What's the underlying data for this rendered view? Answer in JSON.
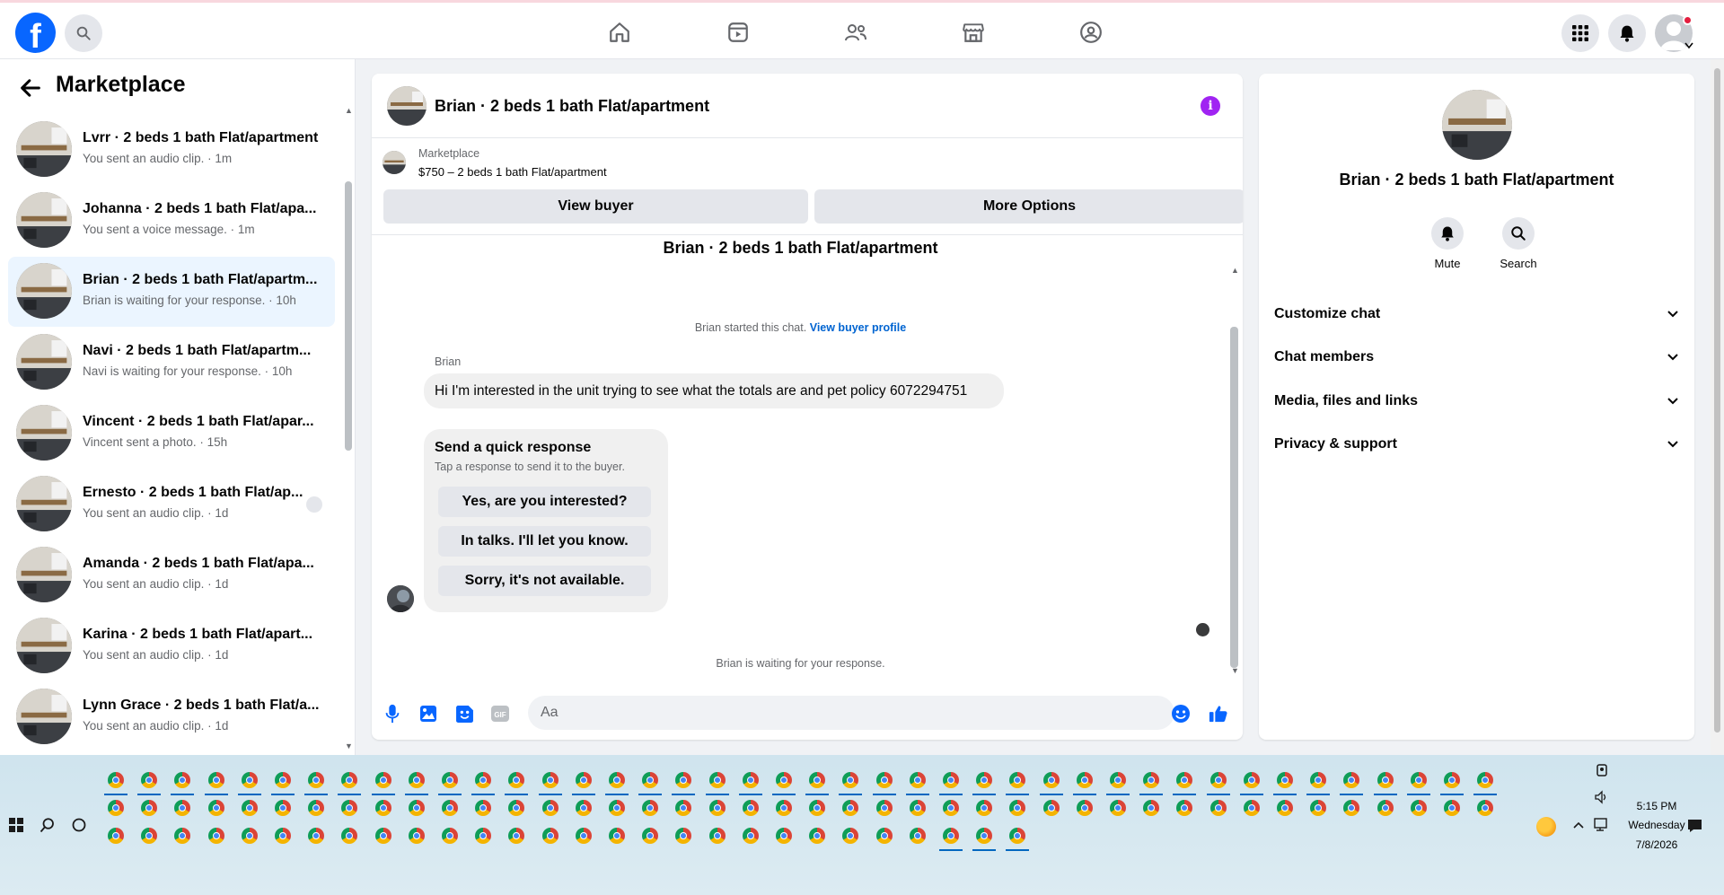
{
  "topbar": {
    "logo": "f",
    "nav_icons": [
      "home-icon",
      "video-icon",
      "friends-icon",
      "marketplace-icon",
      "groups-icon"
    ],
    "right_icons": [
      "menu-grid-icon",
      "bell-icon",
      "account-avatar"
    ]
  },
  "sidebar": {
    "title": "Marketplace",
    "conversations": [
      {
        "name": "Lvrr · 2 beds 1 bath Flat/apartment",
        "sub": "You sent an audio clip. · 1m"
      },
      {
        "name": "Johanna · 2 beds 1 bath Flat/apa...",
        "sub": "You sent a voice message. · 1m"
      },
      {
        "name": "Brian · 2 beds 1 bath Flat/apartm...",
        "sub": "Brian is waiting for your response. · 10h"
      },
      {
        "name": "Navi · 2 beds 1 bath Flat/apartm...",
        "sub": "Navi is waiting for your response. · 10h"
      },
      {
        "name": "Vincent · 2 beds 1 bath Flat/apar...",
        "sub": "Vincent sent a photo. · 15h"
      },
      {
        "name": "Ernesto · 2 beds 1 bath Flat/ap...",
        "sub": "You sent an audio clip. · 1d"
      },
      {
        "name": "Amanda · 2 beds 1 bath Flat/apa...",
        "sub": "You sent an audio clip. · 1d"
      },
      {
        "name": "Karina · 2 beds 1 bath Flat/apart...",
        "sub": "You sent an audio clip. · 1d"
      },
      {
        "name": "Lynn Grace · 2 beds 1 bath Flat/a...",
        "sub": "You sent an audio clip. · 1d"
      }
    ]
  },
  "chat": {
    "header_title": "Brian · 2 beds 1 bath Flat/apartment",
    "listing_source": "Marketplace",
    "listing_price": "$750 – 2 beds 1 bath Flat/apartment",
    "view_buyer": "View buyer",
    "more_options": "More Options",
    "thread_title": "Brian · 2 beds 1 bath Flat/apartment",
    "started_text": "Brian started this chat.",
    "view_profile": "View buyer profile",
    "sender": "Brian",
    "message": "Hi I'm interested in the unit trying to see what the totals are and pet policy 6072294751",
    "quick_title": "Send a quick response",
    "quick_sub": "Tap a response to send it to the buyer.",
    "quick_replies": [
      "Yes, are you interested?",
      "In talks. I'll let you know.",
      "Sorry, it's not available."
    ],
    "waiting": "Brian is waiting for your response.",
    "input_placeholder": "Aa"
  },
  "right_panel": {
    "name": "Brian · 2 beds 1 bath Flat/apartment",
    "mute": "Mute",
    "search": "Search",
    "sections": [
      "Customize chat",
      "Chat members",
      "Media, files and links",
      "Privacy & support"
    ]
  },
  "taskbar": {
    "time": "5:15 PM",
    "day": "Wednesday",
    "date": "7/8/2026"
  },
  "colors": {
    "brand": "#0866ff",
    "accent": "#0064d1",
    "info": "#a024f2"
  }
}
